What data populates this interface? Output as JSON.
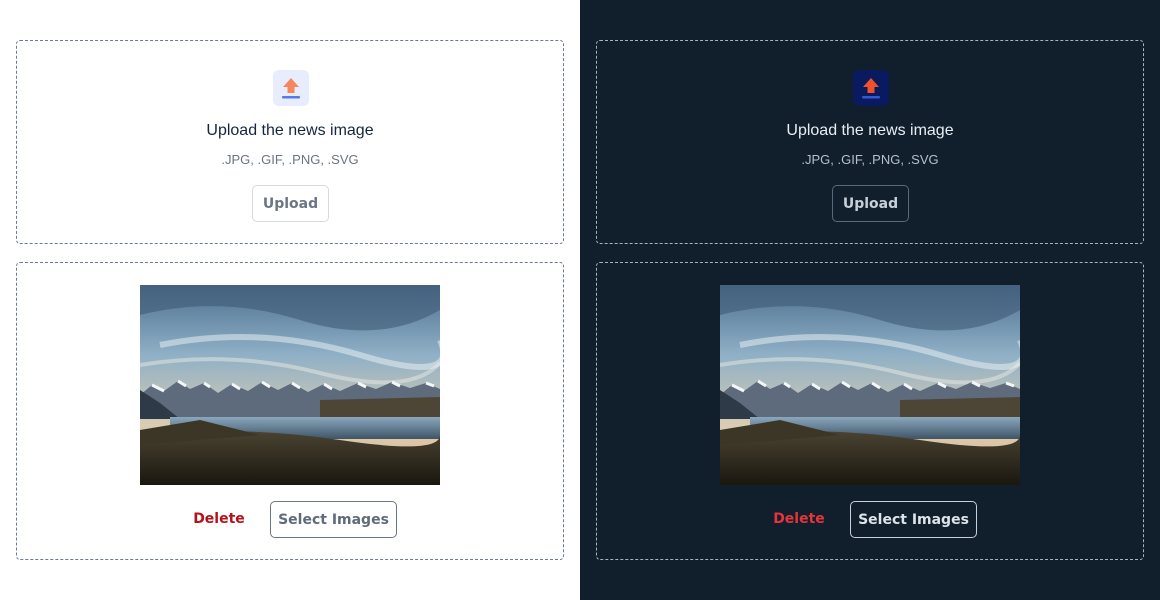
{
  "themes": [
    {
      "id": "light",
      "upload_zone": {
        "icon": "upload-arrow-icon",
        "title": "Upload the news image",
        "formats": ".JPG, .GIF, .PNG, .SVG",
        "upload_label": "Upload"
      },
      "preview_zone": {
        "image_alt": "Mountain lake landscape photo",
        "delete_label": "Delete",
        "select_label": "Select Images"
      }
    },
    {
      "id": "dark",
      "upload_zone": {
        "icon": "upload-arrow-icon",
        "title": "Upload the news image",
        "formats": ".JPG, .GIF, .PNG, .SVG",
        "upload_label": "Upload"
      },
      "preview_zone": {
        "image_alt": "Mountain lake landscape photo",
        "delete_label": "Delete",
        "select_label": "Select Images"
      }
    }
  ],
  "colors": {
    "light_bg": "#ffffff",
    "dark_bg": "#111f2c",
    "upload_arrow": "#f4875d",
    "upload_arrow_dark": "#f0502a",
    "delete_light": "#b5121b",
    "delete_dark": "#e5343a"
  }
}
